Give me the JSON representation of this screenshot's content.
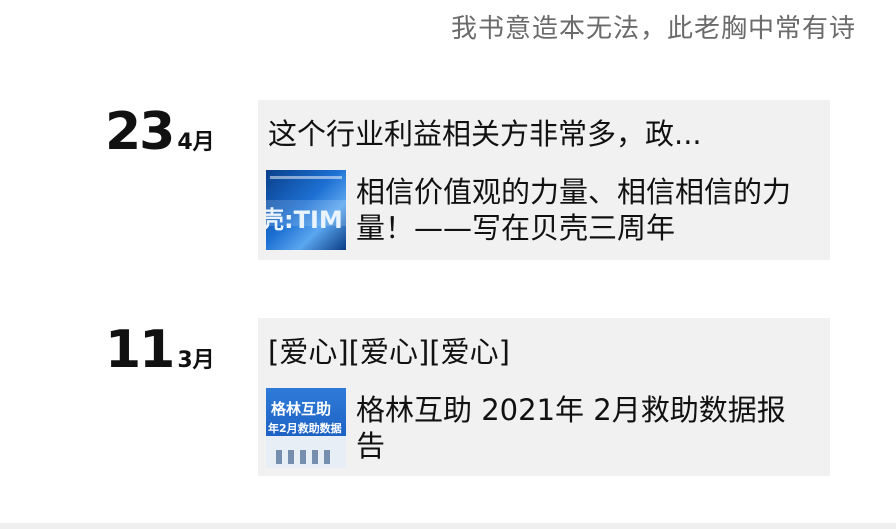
{
  "signature": "我书意造本无法，此老胸中常有诗",
  "posts": [
    {
      "day": "23",
      "month": "4月",
      "text": "这个行业利益相关方非常多，政...",
      "thumb": {
        "lines": [
          "壳:TIM"
        ],
        "icon": "beike-thumbnail"
      },
      "shared_title": "相信价值观的力量、相信相信的力量！——写在贝壳三周年"
    },
    {
      "day": "11",
      "month": "3月",
      "text": "[爱心][爱心][爱心]",
      "thumb": {
        "lines": [
          "格林互助",
          "年2月救助数据"
        ],
        "icon": "gelin-thumbnail"
      },
      "shared_title": "格林互助 2021年 2月救助数据报告"
    }
  ]
}
